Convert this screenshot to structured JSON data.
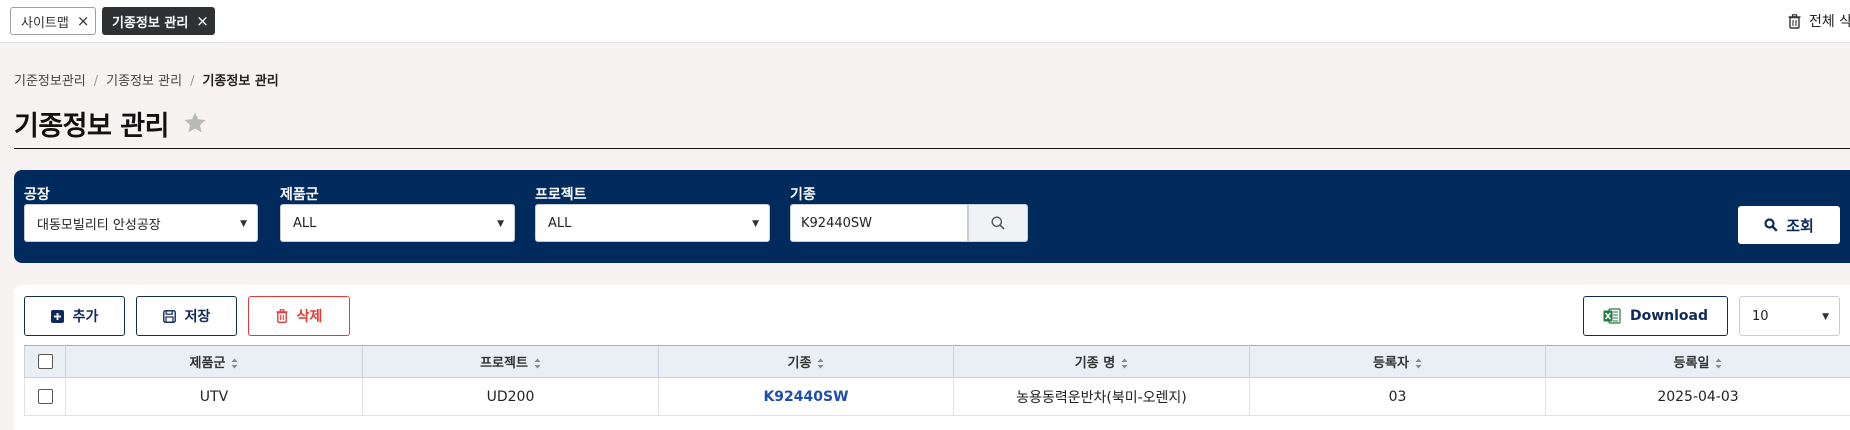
{
  "tabs": [
    {
      "label": "사이트맵",
      "close": "×"
    },
    {
      "label": "기종정보 관리",
      "close": "×"
    }
  ],
  "tabbar": {
    "delete_all_label": "전체 삭제"
  },
  "breadcrumb": [
    "기준정보관리",
    "기종정보 관리",
    "기종정보 관리"
  ],
  "breadcrumb_separator": "/",
  "page": {
    "title": "기종정보 관리"
  },
  "filters": {
    "factory": {
      "label": "공장",
      "value": "대동모빌리티 안성공장"
    },
    "product_group": {
      "label": "제품군",
      "value": "ALL"
    },
    "project": {
      "label": "프로젝트",
      "value": "ALL"
    },
    "model": {
      "label": "기종",
      "value": "K92440SW"
    },
    "query_label": "조회"
  },
  "toolbar": {
    "add_label": "추가",
    "save_label": "저장",
    "delete_label": "삭제",
    "download_label": "Download",
    "page_size": "10"
  },
  "table": {
    "columns": [
      "제품군",
      "프로젝트",
      "기종",
      "기종 명",
      "등록자",
      "등록일"
    ],
    "rows": [
      {
        "product_group": "UTV",
        "project": "UD200",
        "model": "K92440SW",
        "model_name": "농용동력운반차(북미-오렌지)",
        "registrant": "03",
        "registered_date": "2025-04-03"
      }
    ]
  },
  "colors": {
    "panel_navy": "#002b5c",
    "primary_text": "#0f2a5a",
    "delete_red": "#e53935",
    "link_blue": "#1d4fa8",
    "excel_green": "#1f7a3f"
  },
  "icons": [
    "close-icon",
    "trash-icon",
    "star-icon",
    "caret-down-icon",
    "search-icon",
    "plus-square-icon",
    "floppy-icon",
    "excel-icon",
    "sort-icon",
    "checkbox"
  ]
}
